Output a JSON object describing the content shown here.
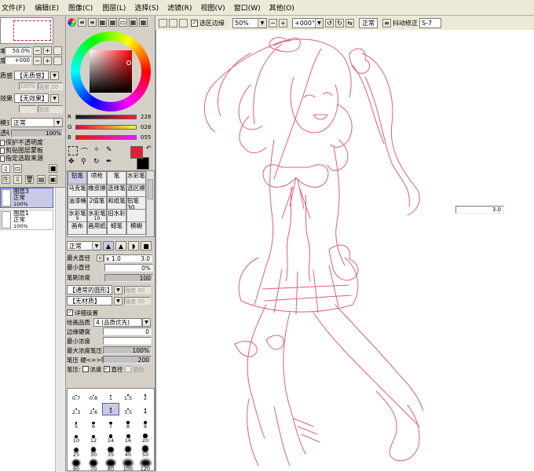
{
  "menu": [
    "文件",
    "编辑",
    "图像",
    "图层",
    "选择",
    "滤镜",
    "视图",
    "窗口",
    "其他"
  ],
  "menu_letters": [
    "F",
    "E",
    "C",
    "L",
    "S",
    "R",
    "V",
    "W",
    "O"
  ],
  "toolbar": {
    "selection_edge_label": "选区边缘",
    "zoom_value": "50%",
    "rotate_value": "+000°",
    "blend_mode": "正常",
    "stabilizer_label": "抖动修正",
    "stabilizer_value": "S-7"
  },
  "navigator": {
    "zoom": "50.0%",
    "rotate": "+000"
  },
  "layer_panel": {
    "texture_label": "质感",
    "texture_value": "【无质感】",
    "texture_hint1": "100%",
    "texture_hint2": "强度 20",
    "effect_label": "效果",
    "effect_value": "【无效果】",
    "effect_hint": "宽度",
    "mode_label": "模式",
    "mode_value": "正常",
    "opacity_label": "透明度",
    "opacity_value": "100%",
    "check_preserve": "保护不透明度",
    "check_clip": "剪贴图层蒙板",
    "check_select_source": "指定选取来源",
    "layers": [
      {
        "name": "图层3",
        "mode": "正常",
        "opacity": "100%"
      },
      {
        "name": "图层1",
        "mode": "正常",
        "opacity": "100%"
      }
    ]
  },
  "color": {
    "r_label": "R",
    "g_label": "G",
    "b_label": "B",
    "r_value": "228",
    "g_value": "028",
    "b_value": "055",
    "fg_color": "#e41c37"
  },
  "tools": [
    {
      "name": "铅笔",
      "sub": ""
    },
    {
      "name": "喷枪",
      "sub": ""
    },
    {
      "name": "笔",
      "sub": ""
    },
    {
      "name": "水彩笔",
      "sub": ""
    },
    {
      "name": "马克笔",
      "sub": ""
    },
    {
      "name": "橡皮擦",
      "sub": ""
    },
    {
      "name": "选择笔",
      "sub": ""
    },
    {
      "name": "选区擦",
      "sub": ""
    },
    {
      "name": "油漆桶",
      "sub": ""
    },
    {
      "name": "2值笔",
      "sub": ""
    },
    {
      "name": "和纸笔",
      "sub": ""
    },
    {
      "name": "铅笔30",
      "sub": ""
    },
    {
      "name": "水彩笔",
      "sub": "9"
    },
    {
      "name": "水彩笔",
      "sub": "10"
    },
    {
      "name": "旧水彩",
      "sub": ""
    },
    {
      "name": "",
      "sub": ""
    },
    {
      "name": "画布",
      "sub": ""
    },
    {
      "name": "画用纸",
      "sub": ""
    },
    {
      "name": "蜡笔",
      "sub": ""
    },
    {
      "name": "模糊",
      "sub": ""
    }
  ],
  "brush": {
    "mode": "正常",
    "max_size_label": "最大直径",
    "max_size_mult": "x 1.0",
    "max_size_value": "3.0",
    "min_size_label": "最小直径",
    "min_size_value": "0%",
    "density_label": "笔刷浓度",
    "density_value": "100",
    "shape_value": "【通常的圆形】",
    "shape_hint": "强度 50",
    "texture_value": "【无材质】",
    "texture_hint": "强度 50",
    "detail_label": "详细设置",
    "quality_label": "绘画品质",
    "quality_value": "4 (品质优先)",
    "edge_label": "边缘硬度",
    "edge_value": "0",
    "min_density_label": "最小浓度",
    "min_density_value": "",
    "max_pressure_label": "最大浓度笔压",
    "max_pressure_value": "100%",
    "pressure_label": "笔压 硬<=>软",
    "pressure_value": "200",
    "pen_pressure_label": "笔压:",
    "pp_density": "浓度",
    "pp_size": "直径",
    "pp_mix": "混色"
  },
  "brush_sizes": [
    "0.7",
    "0.8",
    "1",
    "1.5",
    "2",
    "2.3",
    "2.6",
    "3",
    "3.5",
    "4",
    "5",
    "6",
    "7",
    "8",
    "9",
    "10",
    "12",
    "14",
    "16",
    "20",
    "25",
    "30",
    "35",
    "40",
    "50",
    "60",
    "70",
    "80",
    "100",
    "120"
  ],
  "canvas_float_value": "3.0"
}
